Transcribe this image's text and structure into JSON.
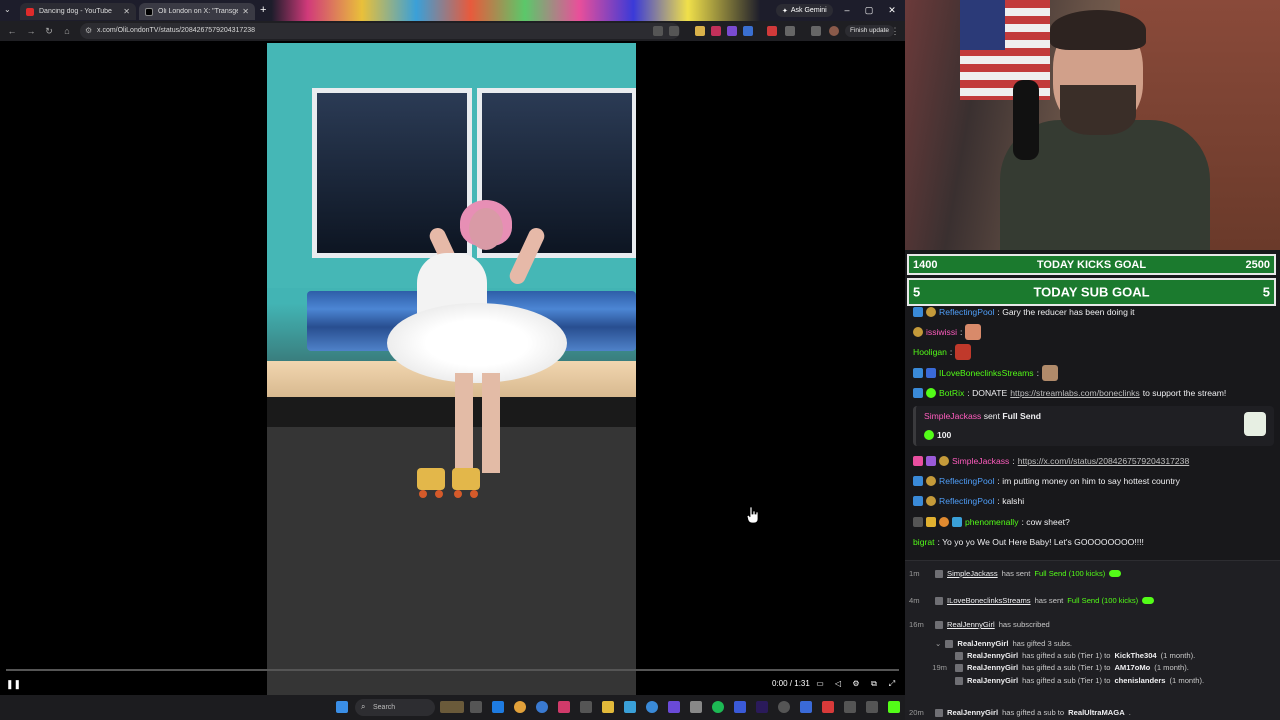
{
  "browser": {
    "tabs": [
      {
        "title": "Dancing dog - YouTube"
      },
      {
        "title": "Oli London on X: \"Transge..."
      }
    ],
    "ask_gemini": "Ask Gemini",
    "url": "x.com/OliLondonTV/status/2084267579204317238",
    "finish_update": "Finish update"
  },
  "video": {
    "time": "0:00 / 1:31",
    "progress": 0.0
  },
  "taskbar": {
    "search_label": "Search"
  },
  "stream": {
    "kicks_goal": {
      "current": "1400",
      "label": "TODAY KICKS GOAL",
      "target": "2500"
    },
    "sub_goal": {
      "current": "5",
      "label": "TODAY SUB GOAL",
      "target": "5"
    },
    "chat": [
      {
        "user": "ReflectingPool",
        "color": "#4f9ef8",
        "text": ": Gary the reducer has been doing it"
      },
      {
        "user": "issiwissi",
        "color": "#ff5cbe",
        "text": ":"
      },
      {
        "user": "Hooligan",
        "color": "#53fc18",
        "text": ":"
      },
      {
        "user": "ILoveBoneclinksStreams",
        "color": "#53fc18",
        "text": ":"
      },
      {
        "user": "BotRix",
        "color": "#53fc18",
        "text_pre": ": DONATE ",
        "link": "https://streamlabs.com/boneclinks",
        "text_post": " to support the stream!"
      },
      {
        "user": "SimpleJackass",
        "color": "#ff5cbe",
        "text": ":",
        "link": "https://x.com/i/status/2084267579204317238"
      },
      {
        "user": "ReflectingPool",
        "color": "#4f9ef8",
        "text": ": im putting money on him to say hottest country"
      },
      {
        "user": "ReflectingPool",
        "color": "#4f9ef8",
        "text": ": kalshi"
      },
      {
        "user": "phenomenally",
        "color": "#53fc18",
        "text": ": cow sheet?"
      },
      {
        "user": "bigrat",
        "color": "#53fc18",
        "text": ": Yo yo yo We Out Here Baby! Let's GOOOOOOOO!!!!"
      }
    ],
    "send_card": {
      "user": "SimpleJackass",
      "action": " sent ",
      "item": "Full Send",
      "amount": "100"
    },
    "activity": [
      {
        "ago": "1m",
        "user": "SimpleJackass",
        "mid": " has sent ",
        "what": "Full Send (100 kicks)"
      },
      {
        "ago": "4m",
        "user": "ILoveBoneclinksStreams",
        "mid": " has sent ",
        "what": "Full Send (100 kicks)"
      },
      {
        "ago": "16m",
        "user": "RealJennyGirl",
        "mid": " has subscribed",
        "what": ""
      },
      {
        "ago": "",
        "user": "RealJennyGirl",
        "mid": " has gifted 3 subs.",
        "what": ""
      },
      {
        "ago": "",
        "user": "RealJennyGirl",
        "mid": " has gifted a sub (Tier 1) to ",
        "to": "KickThe304",
        "tail": " (1 month)."
      },
      {
        "ago": "19m",
        "user": "RealJennyGirl",
        "mid": " has gifted a sub (Tier 1) to ",
        "to": "AM17oMo",
        "tail": " (1 month)."
      },
      {
        "ago": "",
        "user": "RealJennyGirl",
        "mid": " has gifted a sub (Tier 1) to ",
        "to": "chenislanders",
        "tail": " (1 month)."
      },
      {
        "ago": "20m",
        "user": "RealJennyGirl",
        "mid": " has gifted a sub to ",
        "to": "RealUltraMAGA",
        "tail": "."
      }
    ]
  },
  "colors": {
    "kick_green": "#53fc18",
    "goal_green": "#1b7a2e",
    "link_blue": "#1d9bf0"
  }
}
